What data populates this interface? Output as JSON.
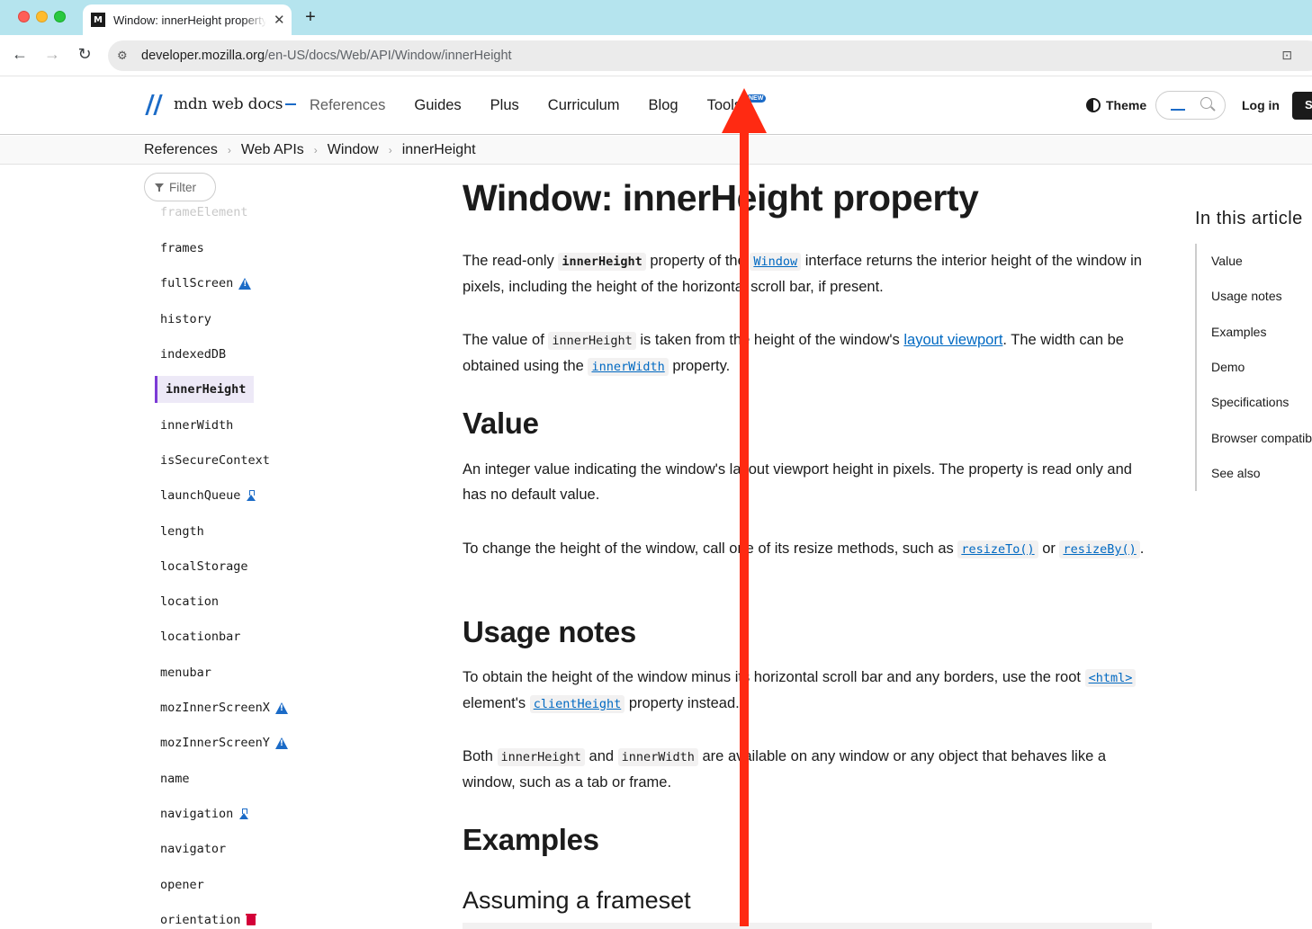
{
  "browser": {
    "tab_title": "Window: innerHeight property",
    "tab_favicon": "M",
    "close_glyph": "✕",
    "new_tab_glyph": "+",
    "url_host": "developer.mozilla.org",
    "url_path": "/en-US/docs/Web/API/Window/innerHeight",
    "back_glyph": "←",
    "forward_glyph": "→",
    "reload_glyph": "↻",
    "site_info_glyph": "⚙",
    "install_glyph": "⊡"
  },
  "header": {
    "logo_text": "mdn web docs",
    "nav": [
      "References",
      "Guides",
      "Plus",
      "Curriculum",
      "Blog",
      "Tools"
    ],
    "new_badge": "NEW",
    "theme_label": "Theme",
    "login_label": "Log in",
    "signup_label": "S"
  },
  "breadcrumbs": [
    "References",
    "Web APIs",
    "Window",
    "innerHeight"
  ],
  "breadcrumb_separator": "›",
  "sidebar": {
    "filter_label": "Filter",
    "items": [
      {
        "label": "frameElement",
        "state": "faded"
      },
      {
        "label": "frames"
      },
      {
        "label": "fullScreen",
        "icon": "warning-icon"
      },
      {
        "label": "history"
      },
      {
        "label": "indexedDB"
      },
      {
        "label": "innerHeight",
        "state": "active"
      },
      {
        "label": "innerWidth"
      },
      {
        "label": "isSecureContext"
      },
      {
        "label": "launchQueue",
        "icon": "experimental-flask-icon"
      },
      {
        "label": "length"
      },
      {
        "label": "localStorage"
      },
      {
        "label": "location"
      },
      {
        "label": "locationbar"
      },
      {
        "label": "menubar"
      },
      {
        "label": "mozInnerScreenX",
        "icon": "warning-icon"
      },
      {
        "label": "mozInnerScreenY",
        "icon": "warning-icon"
      },
      {
        "label": "name"
      },
      {
        "label": "navigation",
        "icon": "experimental-flask-icon"
      },
      {
        "label": "navigator"
      },
      {
        "label": "opener"
      },
      {
        "label": "orientation",
        "icon": "deprecated-trash-icon"
      }
    ]
  },
  "article": {
    "title": "Window: innerHeight property",
    "intro": {
      "t1": "The read-only ",
      "c1": "innerHeight",
      "t2": " property of the ",
      "link1": "Window",
      "t3": " interface returns the interior height of the window in pixels, including the height of the horizontal scroll bar, if present."
    },
    "p2": {
      "t1": "The value of ",
      "c1": "innerHeight",
      "t2": " is taken from the height of the window's ",
      "link1": "layout viewport",
      "t3": ". The width can be obtained using the ",
      "link2": "innerWidth",
      "t4": " property."
    },
    "value_heading": "Value",
    "value_p1": "An integer value indicating the window's layout viewport height in pixels. The property is read only and has no default value.",
    "value_p2": {
      "t1": "To change the height of the window, call one of its resize methods, such as ",
      "link1": "resizeTo()",
      "t2": " or ",
      "link2": "resizeBy()",
      "t3": "."
    },
    "usage_heading": "Usage notes",
    "usage_p1": {
      "t1": "To obtain the height of the window minus its horizontal scroll bar and any borders, use the root ",
      "link1": "<html>",
      "t2": " element's ",
      "link2": "clientHeight",
      "t3": " property instead."
    },
    "usage_p2": {
      "t1": "Both ",
      "c1": "innerHeight",
      "t2": " and ",
      "c2": "innerWidth",
      "t3": " are available on any window or any object that behaves like a window, such as a tab or frame."
    },
    "examples_heading": "Examples",
    "frameset_heading": "Assuming a frameset"
  },
  "toc": {
    "title": "In this article",
    "items": [
      "Value",
      "Usage notes",
      "Examples",
      "Demo",
      "Specifications",
      "Browser compatibility",
      "See also"
    ]
  },
  "annotation": {
    "type": "red-arrow-pointing-up",
    "color": "#ff2a12"
  },
  "colors": {
    "tabbar_bg": "#b5e4ee",
    "link": "#0069c2",
    "active_sidebar_accent": "#7c3bd6",
    "warning_icon": "#1b6bc7",
    "deprecated_icon": "#d30038"
  }
}
